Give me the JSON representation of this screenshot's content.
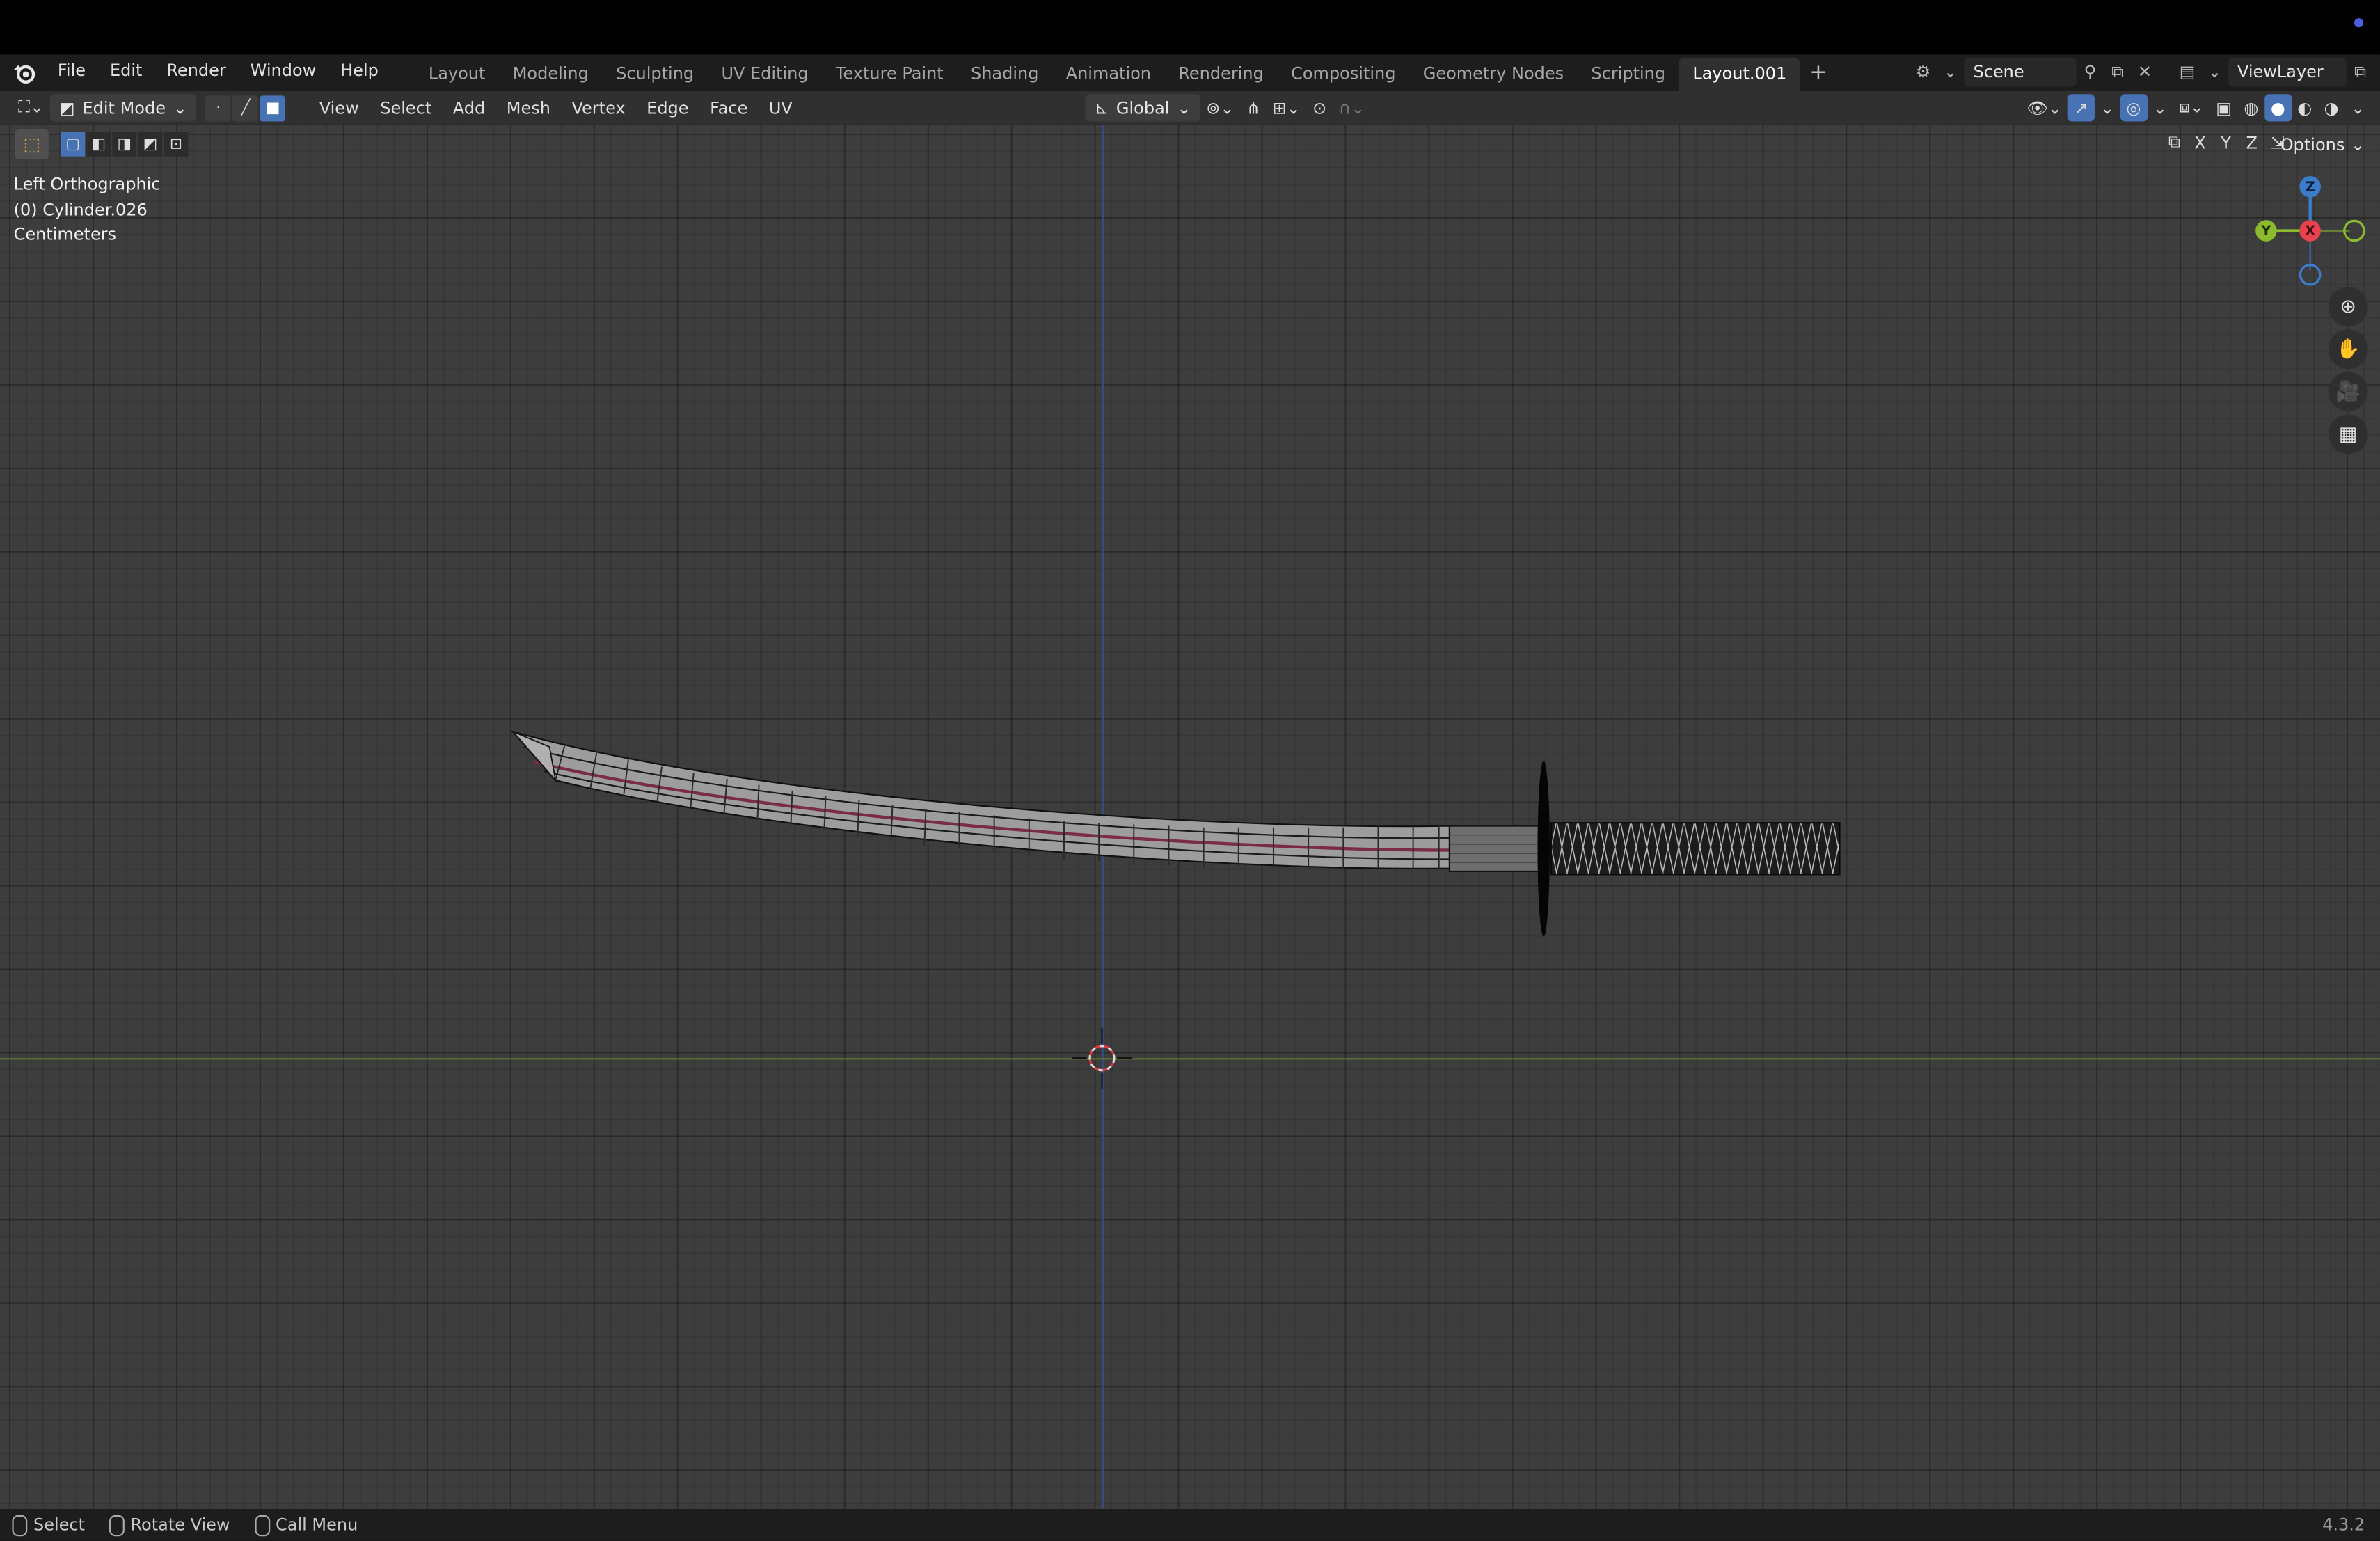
{
  "topbar": {
    "menus": [
      "File",
      "Edit",
      "Render",
      "Window",
      "Help"
    ],
    "workspaces": [
      "Layout",
      "Modeling",
      "Sculpting",
      "UV Editing",
      "Texture Paint",
      "Shading",
      "Animation",
      "Rendering",
      "Compositing",
      "Geometry Nodes",
      "Scripting",
      "Layout.001"
    ],
    "active_workspace": "Layout.001",
    "add_tab": "+",
    "scene": "Scene",
    "view_layer": "ViewLayer"
  },
  "header": {
    "mode": "Edit Mode",
    "menus": [
      "View",
      "Select",
      "Add",
      "Mesh",
      "Vertex",
      "Edge",
      "Face",
      "UV"
    ],
    "transform_orientation": "Global"
  },
  "viewport": {
    "view_name": "Left Orthographic",
    "object_name": "(0) Cylinder.026",
    "units": "Centimeters",
    "axis_x": "X",
    "axis_y": "Y",
    "axis_z": "Z",
    "options_label": "Options",
    "gizmo": {
      "z": "Z",
      "y": "Y",
      "x": "X"
    }
  },
  "statusbar": {
    "select": "Select",
    "rotate": "Rotate View",
    "call_menu": "Call Menu",
    "version": "4.3.2"
  },
  "colors": {
    "accent": "#4772b3",
    "x_axis": "#e8424f",
    "y_axis": "#8cbb2e",
    "z_axis": "#3d7ccb"
  }
}
